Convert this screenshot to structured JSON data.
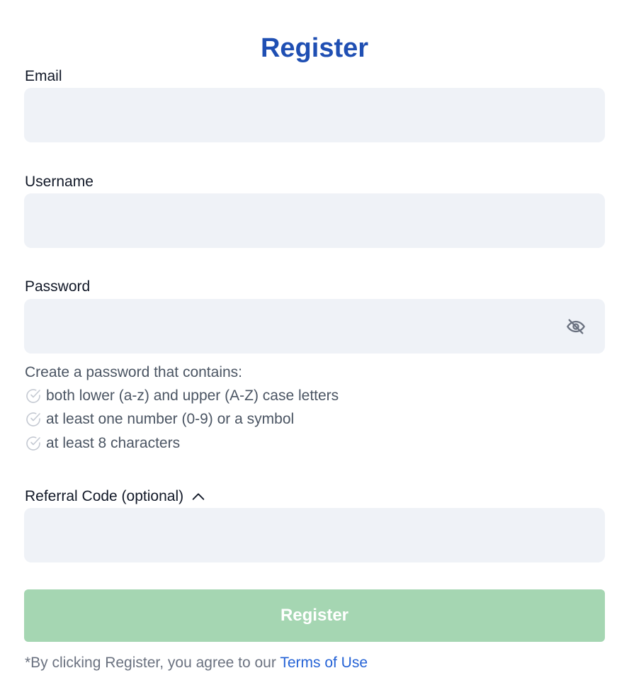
{
  "page": {
    "title": "Register"
  },
  "fields": {
    "email": {
      "label": "Email",
      "value": "",
      "placeholder": ""
    },
    "username": {
      "label": "Username",
      "value": "",
      "placeholder": ""
    },
    "password": {
      "label": "Password",
      "value": "",
      "placeholder": "",
      "toggle_icon": "eye-off-icon"
    },
    "referral": {
      "label": "Referral Code (optional)",
      "value": "",
      "placeholder": "",
      "toggle_icon": "chevron-up-icon"
    }
  },
  "password_rules": {
    "intro": "Create a password that contains:",
    "items": [
      "both lower (a-z) and upper (A-Z) case letters",
      "at least one number (0-9) or a symbol",
      "at least 8 characters"
    ],
    "icon": "check-circle-icon"
  },
  "submit": {
    "label": "Register"
  },
  "terms": {
    "prefix": "*By clicking Register, you agree to our ",
    "link": "Terms of Use"
  },
  "colors": {
    "title": "#1f4fb3",
    "input_bg": "#eff2f7",
    "submit_bg": "#a5d6b2",
    "link": "#2563d6"
  }
}
